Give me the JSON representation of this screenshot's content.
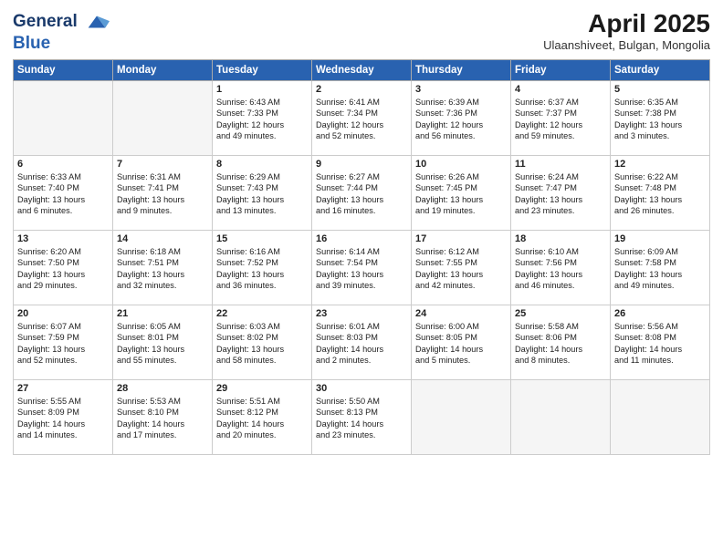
{
  "header": {
    "logo_line1": "General",
    "logo_line2": "Blue",
    "month_title": "April 2025",
    "location": "Ulaanshiveet, Bulgan, Mongolia"
  },
  "weekdays": [
    "Sunday",
    "Monday",
    "Tuesday",
    "Wednesday",
    "Thursday",
    "Friday",
    "Saturday"
  ],
  "weeks": [
    [
      {
        "day": "",
        "text": ""
      },
      {
        "day": "",
        "text": ""
      },
      {
        "day": "1",
        "text": "Sunrise: 6:43 AM\nSunset: 7:33 PM\nDaylight: 12 hours\nand 49 minutes."
      },
      {
        "day": "2",
        "text": "Sunrise: 6:41 AM\nSunset: 7:34 PM\nDaylight: 12 hours\nand 52 minutes."
      },
      {
        "day": "3",
        "text": "Sunrise: 6:39 AM\nSunset: 7:36 PM\nDaylight: 12 hours\nand 56 minutes."
      },
      {
        "day": "4",
        "text": "Sunrise: 6:37 AM\nSunset: 7:37 PM\nDaylight: 12 hours\nand 59 minutes."
      },
      {
        "day": "5",
        "text": "Sunrise: 6:35 AM\nSunset: 7:38 PM\nDaylight: 13 hours\nand 3 minutes."
      }
    ],
    [
      {
        "day": "6",
        "text": "Sunrise: 6:33 AM\nSunset: 7:40 PM\nDaylight: 13 hours\nand 6 minutes."
      },
      {
        "day": "7",
        "text": "Sunrise: 6:31 AM\nSunset: 7:41 PM\nDaylight: 13 hours\nand 9 minutes."
      },
      {
        "day": "8",
        "text": "Sunrise: 6:29 AM\nSunset: 7:43 PM\nDaylight: 13 hours\nand 13 minutes."
      },
      {
        "day": "9",
        "text": "Sunrise: 6:27 AM\nSunset: 7:44 PM\nDaylight: 13 hours\nand 16 minutes."
      },
      {
        "day": "10",
        "text": "Sunrise: 6:26 AM\nSunset: 7:45 PM\nDaylight: 13 hours\nand 19 minutes."
      },
      {
        "day": "11",
        "text": "Sunrise: 6:24 AM\nSunset: 7:47 PM\nDaylight: 13 hours\nand 23 minutes."
      },
      {
        "day": "12",
        "text": "Sunrise: 6:22 AM\nSunset: 7:48 PM\nDaylight: 13 hours\nand 26 minutes."
      }
    ],
    [
      {
        "day": "13",
        "text": "Sunrise: 6:20 AM\nSunset: 7:50 PM\nDaylight: 13 hours\nand 29 minutes."
      },
      {
        "day": "14",
        "text": "Sunrise: 6:18 AM\nSunset: 7:51 PM\nDaylight: 13 hours\nand 32 minutes."
      },
      {
        "day": "15",
        "text": "Sunrise: 6:16 AM\nSunset: 7:52 PM\nDaylight: 13 hours\nand 36 minutes."
      },
      {
        "day": "16",
        "text": "Sunrise: 6:14 AM\nSunset: 7:54 PM\nDaylight: 13 hours\nand 39 minutes."
      },
      {
        "day": "17",
        "text": "Sunrise: 6:12 AM\nSunset: 7:55 PM\nDaylight: 13 hours\nand 42 minutes."
      },
      {
        "day": "18",
        "text": "Sunrise: 6:10 AM\nSunset: 7:56 PM\nDaylight: 13 hours\nand 46 minutes."
      },
      {
        "day": "19",
        "text": "Sunrise: 6:09 AM\nSunset: 7:58 PM\nDaylight: 13 hours\nand 49 minutes."
      }
    ],
    [
      {
        "day": "20",
        "text": "Sunrise: 6:07 AM\nSunset: 7:59 PM\nDaylight: 13 hours\nand 52 minutes."
      },
      {
        "day": "21",
        "text": "Sunrise: 6:05 AM\nSunset: 8:01 PM\nDaylight: 13 hours\nand 55 minutes."
      },
      {
        "day": "22",
        "text": "Sunrise: 6:03 AM\nSunset: 8:02 PM\nDaylight: 13 hours\nand 58 minutes."
      },
      {
        "day": "23",
        "text": "Sunrise: 6:01 AM\nSunset: 8:03 PM\nDaylight: 14 hours\nand 2 minutes."
      },
      {
        "day": "24",
        "text": "Sunrise: 6:00 AM\nSunset: 8:05 PM\nDaylight: 14 hours\nand 5 minutes."
      },
      {
        "day": "25",
        "text": "Sunrise: 5:58 AM\nSunset: 8:06 PM\nDaylight: 14 hours\nand 8 minutes."
      },
      {
        "day": "26",
        "text": "Sunrise: 5:56 AM\nSunset: 8:08 PM\nDaylight: 14 hours\nand 11 minutes."
      }
    ],
    [
      {
        "day": "27",
        "text": "Sunrise: 5:55 AM\nSunset: 8:09 PM\nDaylight: 14 hours\nand 14 minutes."
      },
      {
        "day": "28",
        "text": "Sunrise: 5:53 AM\nSunset: 8:10 PM\nDaylight: 14 hours\nand 17 minutes."
      },
      {
        "day": "29",
        "text": "Sunrise: 5:51 AM\nSunset: 8:12 PM\nDaylight: 14 hours\nand 20 minutes."
      },
      {
        "day": "30",
        "text": "Sunrise: 5:50 AM\nSunset: 8:13 PM\nDaylight: 14 hours\nand 23 minutes."
      },
      {
        "day": "",
        "text": ""
      },
      {
        "day": "",
        "text": ""
      },
      {
        "day": "",
        "text": ""
      }
    ]
  ]
}
